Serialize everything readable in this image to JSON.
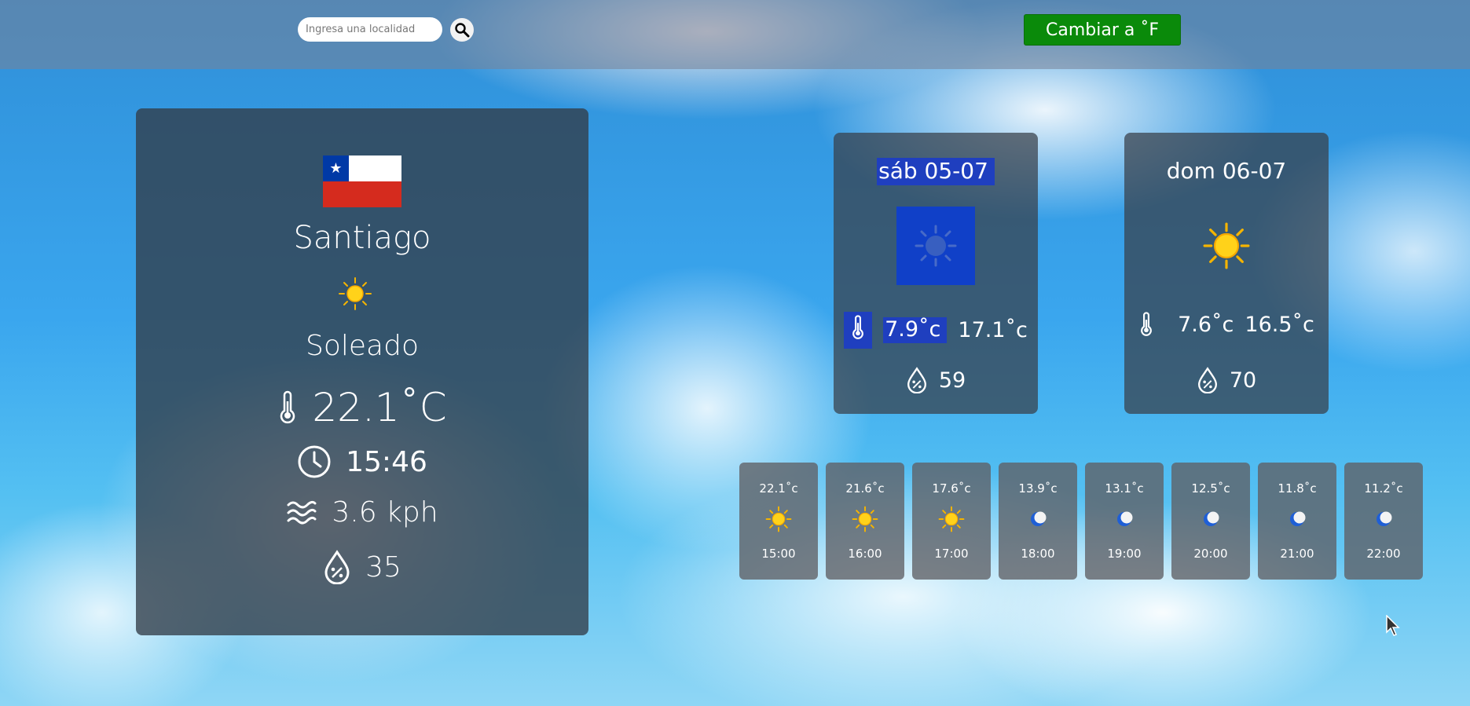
{
  "search": {
    "placeholder": "Ingresa una localidad"
  },
  "unit_toggle": {
    "label": "Cambiar a ˚F"
  },
  "current": {
    "city": "Santiago",
    "condition": "Soleado",
    "temperature": "22.1˚C",
    "time": "15:46",
    "wind": "3.6 kph",
    "humidity": "35",
    "flag": "chile-flag",
    "icon": "sun-icon"
  },
  "forecast": [
    {
      "date": "sáb 05-07",
      "min": "7.9˚c",
      "max": "17.1˚c",
      "humidity": "59",
      "icon": "sun-icon"
    },
    {
      "date": "dom 06-07",
      "min": "7.6˚c",
      "max": "16.5˚c",
      "humidity": "70",
      "icon": "sun-icon"
    }
  ],
  "hourly": [
    {
      "temp": "22.1˚c",
      "hour": "15:00",
      "icon": "sun-icon"
    },
    {
      "temp": "21.6˚c",
      "hour": "16:00",
      "icon": "sun-icon"
    },
    {
      "temp": "17.6˚c",
      "hour": "17:00",
      "icon": "sun-icon"
    },
    {
      "temp": "13.9˚c",
      "hour": "18:00",
      "icon": "moon-icon"
    },
    {
      "temp": "13.1˚c",
      "hour": "19:00",
      "icon": "moon-icon"
    },
    {
      "temp": "12.5˚c",
      "hour": "20:00",
      "icon": "moon-icon"
    },
    {
      "temp": "11.8˚c",
      "hour": "21:00",
      "icon": "moon-icon"
    },
    {
      "temp": "11.2˚c",
      "hour": "22:00",
      "icon": "moon-icon"
    }
  ],
  "colors": {
    "button_green": "#0a8a0a",
    "selection_blue": "#1f3fbf",
    "panel": "#373e48"
  }
}
